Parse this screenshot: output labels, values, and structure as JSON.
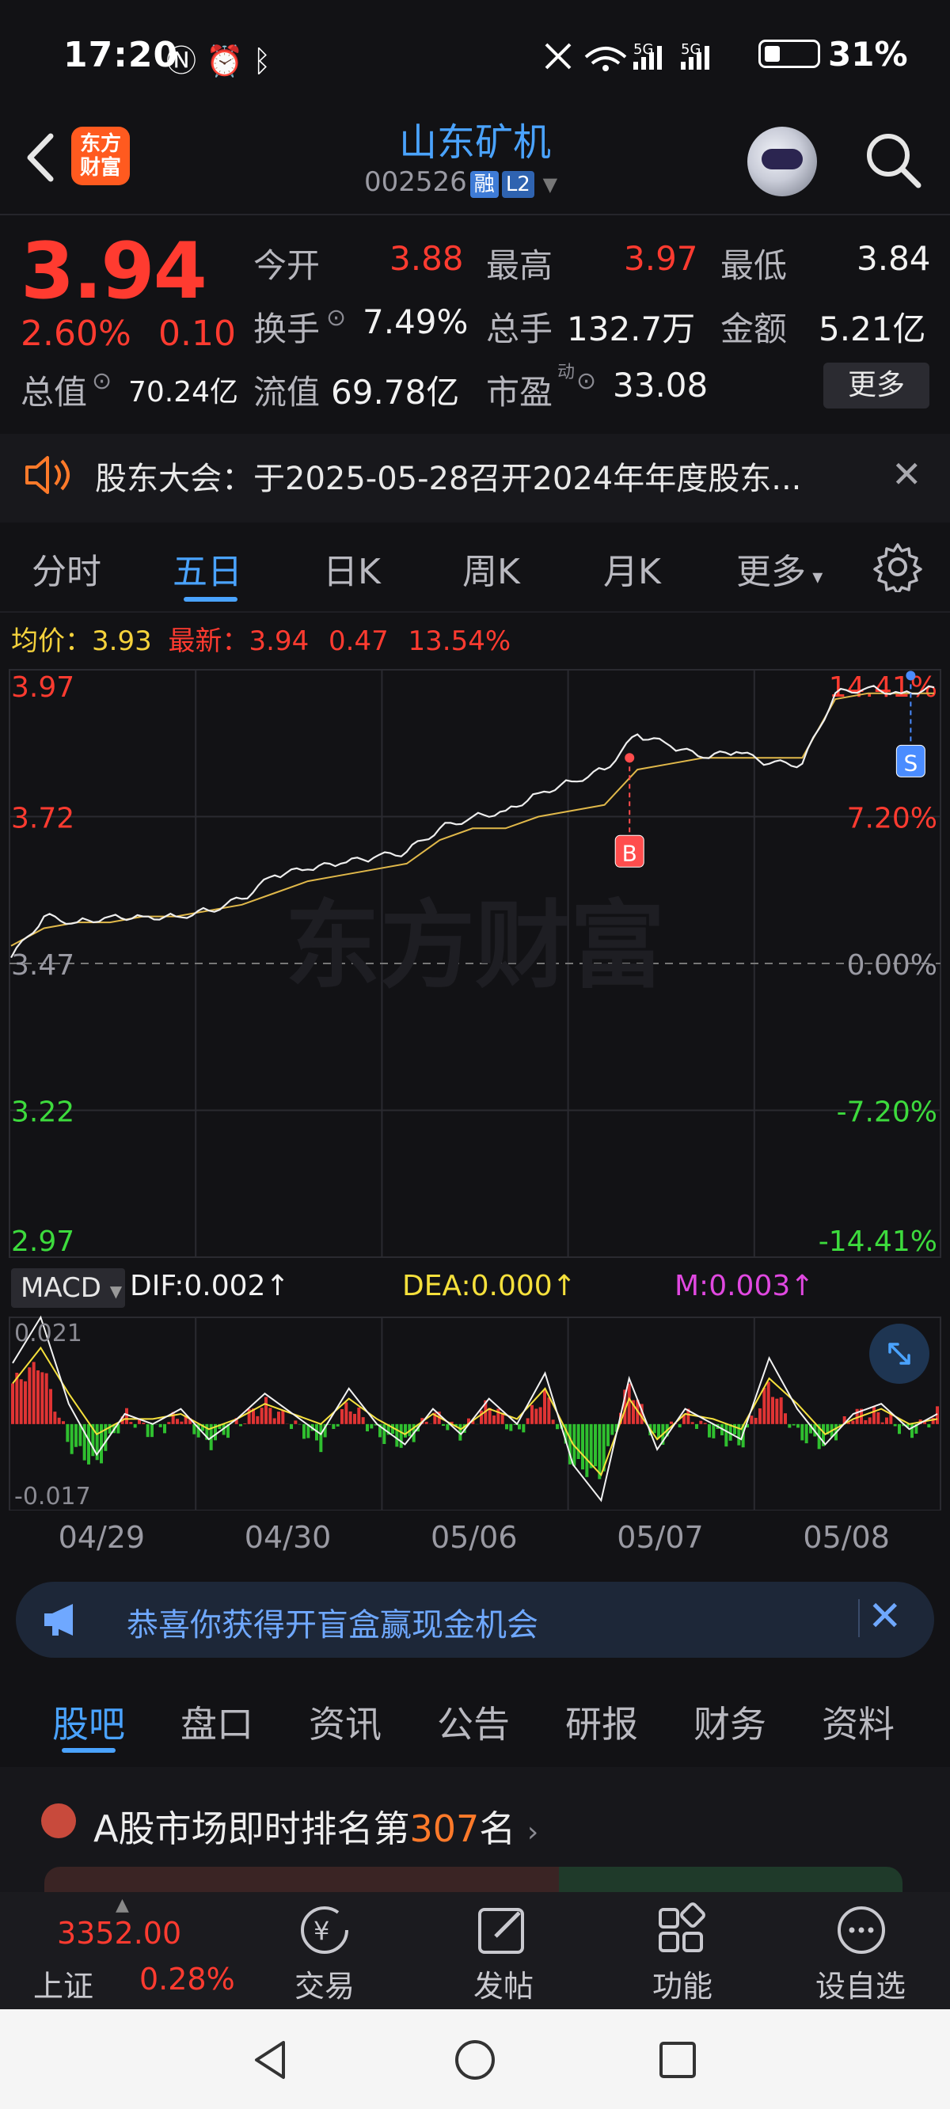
{
  "status_bar": {
    "time": "17:20",
    "battery_pct": "31%",
    "battery_level": 0.31
  },
  "header": {
    "stock_name": "山东矿机",
    "stock_code": "002526",
    "tag_rong": "融",
    "tag_l2": "L2",
    "logo_text_1": "东方",
    "logo_text_2": "财富"
  },
  "quote": {
    "price": "3.94",
    "change_pct": "2.60%",
    "change_abs": "0.10",
    "open_label": "今开",
    "open_value": "3.88",
    "high_label": "最高",
    "high_value": "3.97",
    "low_label": "最低",
    "low_value": "3.84",
    "turnover_label": "换手",
    "turnover_value": "7.49%",
    "volume_label": "总手",
    "volume_value": "132.7万",
    "amount_label": "金额",
    "amount_value": "5.21亿",
    "mktcap_label": "总值",
    "mktcap_value": "70.24亿",
    "float_label": "流值",
    "float_value": "69.78亿",
    "pe_label": "市盈",
    "pe_sup": "动",
    "pe_value": "33.08",
    "more_button": "更多"
  },
  "notice": {
    "text": "股东大会：于2025-05-28召开2024年年度股东..."
  },
  "chart_tabs": [
    "分时",
    "五日",
    "日K",
    "周K",
    "月K",
    "更多"
  ],
  "chart_tabs_active": 1,
  "chart_header": {
    "avg_label": "均价：",
    "avg_value": "3.93",
    "latest_label": "最新：",
    "latest_value": "3.94",
    "latest_change": "0.47",
    "latest_pct": "13.54%"
  },
  "watermark": "东方财富",
  "chart_data": {
    "type": "line",
    "dates": [
      "04/29",
      "04/30",
      "05/06",
      "05/07",
      "05/08"
    ],
    "y_ticks": [
      "3.97",
      "3.72",
      "3.47",
      "3.22",
      "2.97"
    ],
    "pct_ticks": [
      "14.41%",
      "7.20%",
      "0.00%",
      "-7.20%",
      "-14.41%"
    ],
    "ylim": [
      2.97,
      3.97
    ],
    "baseline": 3.47,
    "price_series": [
      3.48,
      3.55,
      3.54,
      3.55,
      3.55,
      3.55,
      3.56,
      3.58,
      3.62,
      3.63,
      3.64,
      3.65,
      3.66,
      3.7,
      3.72,
      3.73,
      3.76,
      3.78,
      3.8,
      3.86,
      3.84,
      3.82,
      3.83,
      3.81,
      3.81,
      3.93,
      3.94,
      3.93,
      3.94
    ],
    "avg_series": [
      3.5,
      3.53,
      3.54,
      3.54,
      3.55,
      3.55,
      3.56,
      3.57,
      3.59,
      3.61,
      3.62,
      3.63,
      3.64,
      3.68,
      3.7,
      3.7,
      3.72,
      3.73,
      3.74,
      3.8,
      3.81,
      3.82,
      3.82,
      3.82,
      3.82,
      3.92,
      3.93,
      3.93,
      3.93
    ],
    "markers": [
      {
        "label": "B",
        "date": "05/07",
        "price": 3.82
      },
      {
        "label": "S",
        "date": "05/08",
        "price": 3.96
      }
    ]
  },
  "macd": {
    "selector": "MACD",
    "dif_label": "DIF:0.002↑",
    "dea_label": "DEA:0.000↑",
    "m_label": "M:0.003↑",
    "top_tick": "0.021",
    "bottom_tick": "-0.017",
    "ylim": [
      -0.017,
      0.021
    ],
    "dif_series": [
      0.012,
      0.021,
      0.004,
      -0.006,
      0.002,
      0.0,
      0.003,
      -0.003,
      0.001,
      0.006,
      0.002,
      -0.002,
      0.007,
      0.0,
      -0.004,
      0.003,
      -0.002,
      0.005,
      0.0,
      0.01,
      -0.008,
      -0.015,
      0.009,
      -0.005,
      0.003,
      0.0,
      -0.003,
      0.013,
      0.003,
      -0.004,
      0.002,
      0.004,
      -0.001,
      0.002
    ],
    "dea_series": [
      0.008,
      0.015,
      0.006,
      -0.002,
      0.001,
      0.001,
      0.002,
      -0.001,
      0.001,
      0.004,
      0.002,
      0.0,
      0.005,
      0.001,
      -0.002,
      0.002,
      -0.001,
      0.003,
      0.001,
      0.007,
      -0.004,
      -0.01,
      0.005,
      -0.003,
      0.002,
      0.001,
      -0.001,
      0.009,
      0.004,
      -0.002,
      0.001,
      0.003,
      0.0,
      0.001
    ]
  },
  "promo": {
    "text": "恭喜你获得开盲盒赢现金机会"
  },
  "lower_tabs": [
    "股吧",
    "盘口",
    "资讯",
    "公告",
    "研报",
    "财务",
    "资料"
  ],
  "lower_tabs_active": 0,
  "rank": {
    "prefix": "A股市场即时排名第",
    "number": "307",
    "suffix": "名"
  },
  "toolbar": {
    "index_value": "3352.00",
    "index_name": "上证",
    "index_pct": "0.28%",
    "trade": "交易",
    "post": "发帖",
    "features": "功能",
    "add_watch": "设自选"
  },
  "colors": {
    "up": "#ff3b30",
    "down": "#3ddb3d",
    "accent": "#4aa3ff",
    "bg": "#121215"
  }
}
